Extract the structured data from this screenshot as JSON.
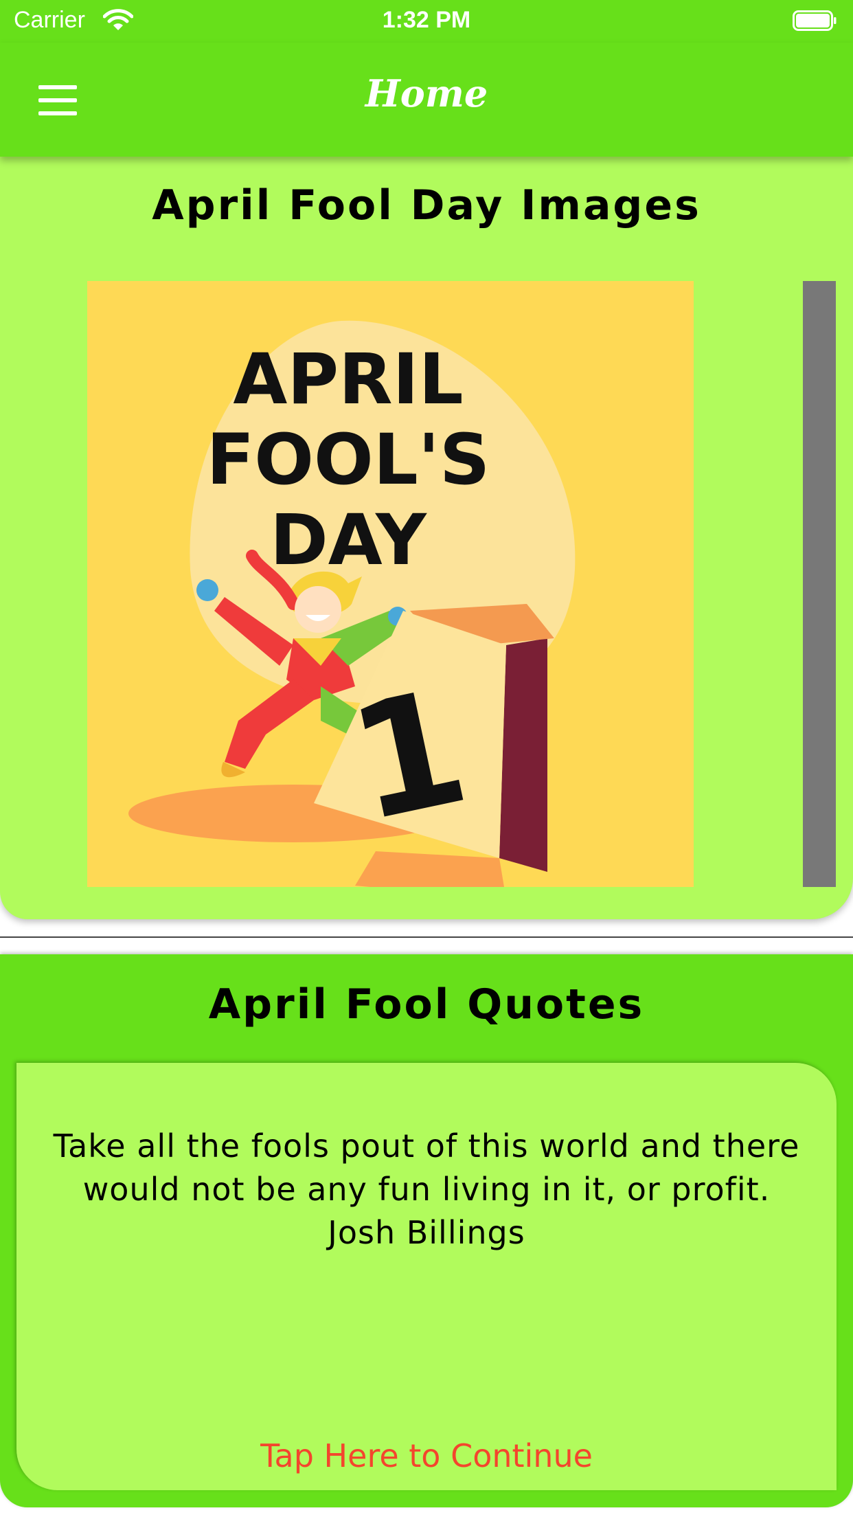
{
  "status_bar": {
    "carrier": "Carrier",
    "time": "1:32 PM"
  },
  "nav": {
    "title": "Home",
    "menu_icon": "hamburger-menu-icon"
  },
  "images_section": {
    "title": "April Fool Day Images",
    "image": {
      "line1": "APRIL",
      "line2": "FOOL'S",
      "line3": "DAY",
      "date_number": "1"
    }
  },
  "quotes_section": {
    "title": "April Fool Quotes",
    "quote_line1": "Take all the fools pout of this world and there",
    "quote_line2": "would not be any fun living in it, or profit.",
    "author": "Josh Billings",
    "continue_label": "Tap Here to Continue"
  },
  "colors": {
    "header_green": "#67e01a",
    "card_light_green": "#b1fb5c",
    "link_red": "#f4452d",
    "image_yellow": "#fed955"
  }
}
